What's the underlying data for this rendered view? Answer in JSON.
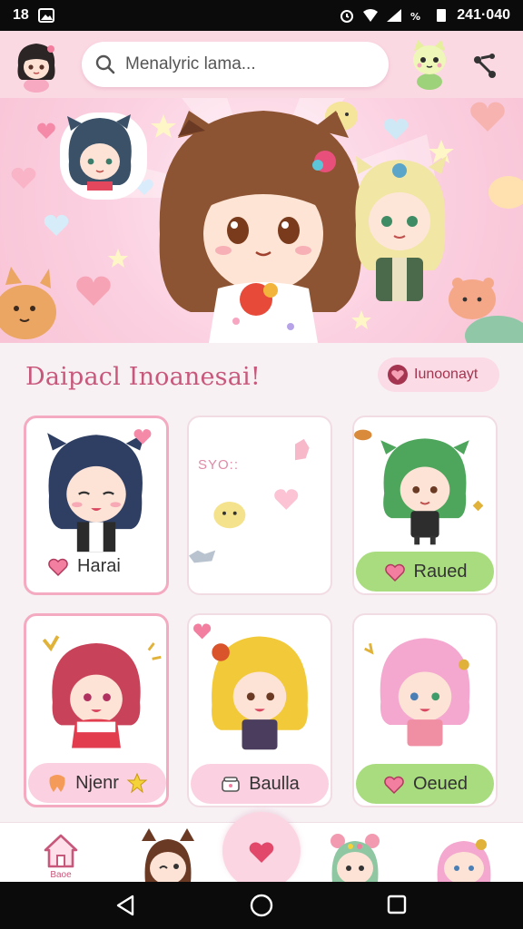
{
  "status_bar": {
    "time_left": "18",
    "time_right": "241·040"
  },
  "search": {
    "placeholder": "Menalyric lama..."
  },
  "section": {
    "title": "Daipacl Inoanesai!",
    "action_label": "Iunoonayt"
  },
  "cards": [
    {
      "label": "Harai",
      "style": "plain",
      "hair": "#2f3f63"
    },
    {
      "label": "SYO::",
      "style": "text",
      "hair": "#f5c2d2"
    },
    {
      "label": "Raued",
      "style": "pill-green",
      "hair": "#4ea55c"
    },
    {
      "label": "Njenr",
      "style": "pill-peach",
      "hair": "#c8425a"
    },
    {
      "label": "Baulla",
      "style": "pill-pink",
      "hair": "#f2c938"
    },
    {
      "label": "Oeued",
      "style": "pill-green",
      "hair": "#f4a8cf"
    }
  ],
  "bottom_nav": {
    "home_label": "Baoe"
  },
  "colors": {
    "accent_pink": "#c8587b",
    "appbar": "#fbd9e3",
    "green_pill": "#a8dc7e"
  }
}
